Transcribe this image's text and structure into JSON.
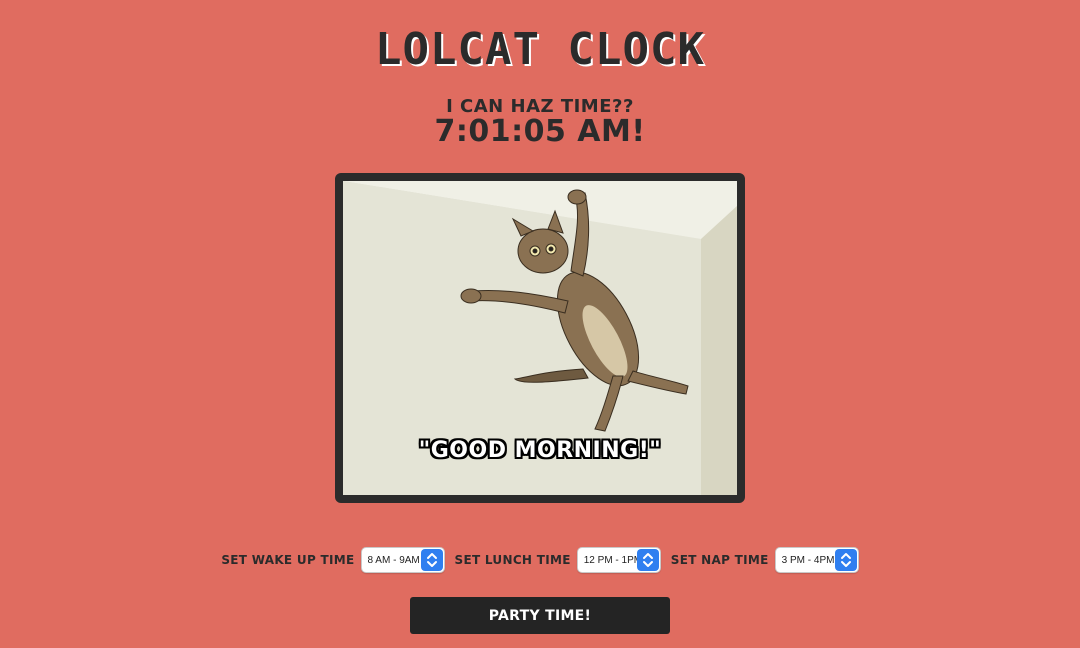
{
  "header": {
    "title": "Lolcat Clock",
    "subtitle": "I CAN HAZ TIME??",
    "time": "7:01:05 AM!"
  },
  "photo": {
    "caption": "\"GOOD MORNING!\""
  },
  "controls": {
    "wake_label": "SET WAKE UP TIME",
    "wake_value": "8 AM - 9AM",
    "lunch_label": "SET LUNCH TIME",
    "lunch_value": "12 PM - 1PM",
    "nap_label": "SET NAP TIME",
    "nap_value": "3 PM - 4PM"
  },
  "party_button": {
    "label": "PARTY TIME!"
  },
  "colors": {
    "background": "#e06c60",
    "text": "#2b2b2b",
    "button": "#242424",
    "select_accent": "#2f7ff0"
  },
  "icons": {
    "select_arrows": "up-down-chevron-icon"
  }
}
